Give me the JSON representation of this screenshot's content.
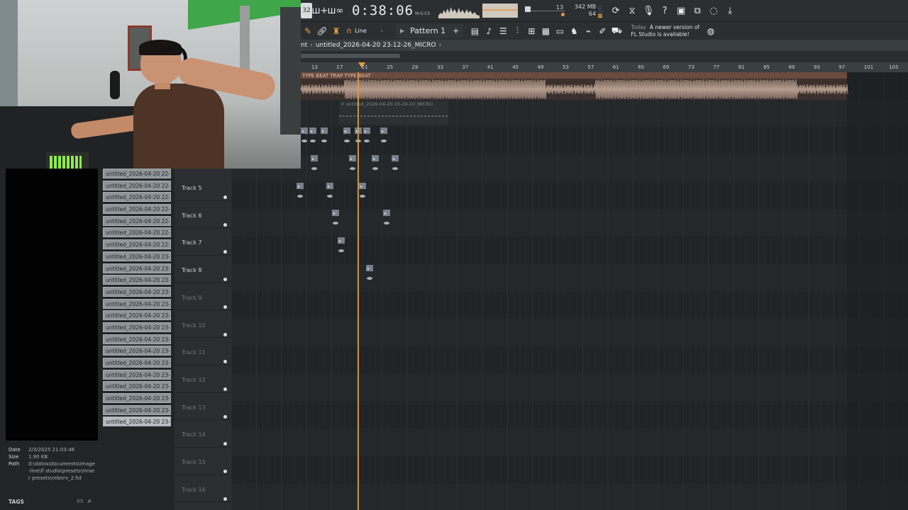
{
  "toolbar": {
    "time_display": "0:38:06",
    "time_unit": "M:S:CS",
    "slider_value": "13",
    "memory_mb": "342 MB",
    "memory_voices": "64",
    "snap_mode": "Line",
    "pattern_name": "Pattern 1",
    "update_day": "Today",
    "update_message_line1": "A newer version of",
    "update_message_line2": "FL Studio is available!",
    "accent_color": "#e79b3a"
  },
  "playlist": {
    "breadcrumb_start": "nt",
    "project_name": "untitled_2026-04-20 23-12-26_MICRO",
    "ruler_marks": [
      "13",
      "17",
      "21",
      "25",
      "29",
      "33",
      "37",
      "41",
      "45",
      "49",
      "53",
      "57",
      "61",
      "65",
      "69",
      "73",
      "77",
      "81",
      "85",
      "89",
      "93",
      "97",
      "101",
      "105"
    ],
    "audio_clip_label": "TYPE BEAT  TRAP TYPE BEAT",
    "sub_clip_label": "untitled_2026-04-20 23-29-10_MICRO",
    "tracks": [
      {
        "name": "Track 5"
      },
      {
        "name": "Track 6"
      },
      {
        "name": "Track 7"
      },
      {
        "name": "Track 8"
      },
      {
        "name": "Track 9"
      },
      {
        "name": "Track 10"
      },
      {
        "name": "Track 11"
      },
      {
        "name": "Track 12"
      },
      {
        "name": "Track 13"
      },
      {
        "name": "Track 14"
      },
      {
        "name": "Track 15"
      },
      {
        "name": "Track 16"
      }
    ]
  },
  "browser": {
    "files": [
      "untitled_2026-04-20 22-...",
      "untitled_2026-04-20 22-...",
      "untitled_2026-04-20 22-...",
      "untitled_2026-04-20 22-...",
      "untitled_2026-04-20 22-...",
      "untitled_2026-04-20 22-...",
      "untitled_2026-04-20 22-...",
      "untitled_2026-04-20 23-...",
      "untitled_2026-04-20 23-...",
      "untitled_2026-04-20 23-...",
      "untitled_2026-04-20 23-...",
      "untitled_2026-04-20 23-...",
      "untitled_2026-04-20 23-...",
      "untitled_2026-04-20 23-...",
      "untitled_2026-04-20 23-...",
      "untitled_2026-04-20 23-...",
      "untitled_2026-04-20 23-...",
      "untitled_2026-04-20 23-...",
      "untitled_2026-04-20 23-...",
      "untitled_2026-04-20 23-...",
      "untitled_2026-04-20 23-...",
      "untitled_2026-04-20 23-..."
    ],
    "info": {
      "date_label": "Date",
      "date_value": "2/3/2025 21:03:46",
      "size_label": "Size",
      "size_value": "1.90 KB",
      "path_label": "Path",
      "path_value": "d:\\datos\\documents\\image-line\\fl studio\\presets\\mixer presets\\reberv_2.fst"
    },
    "tags_label": "TAGS"
  }
}
